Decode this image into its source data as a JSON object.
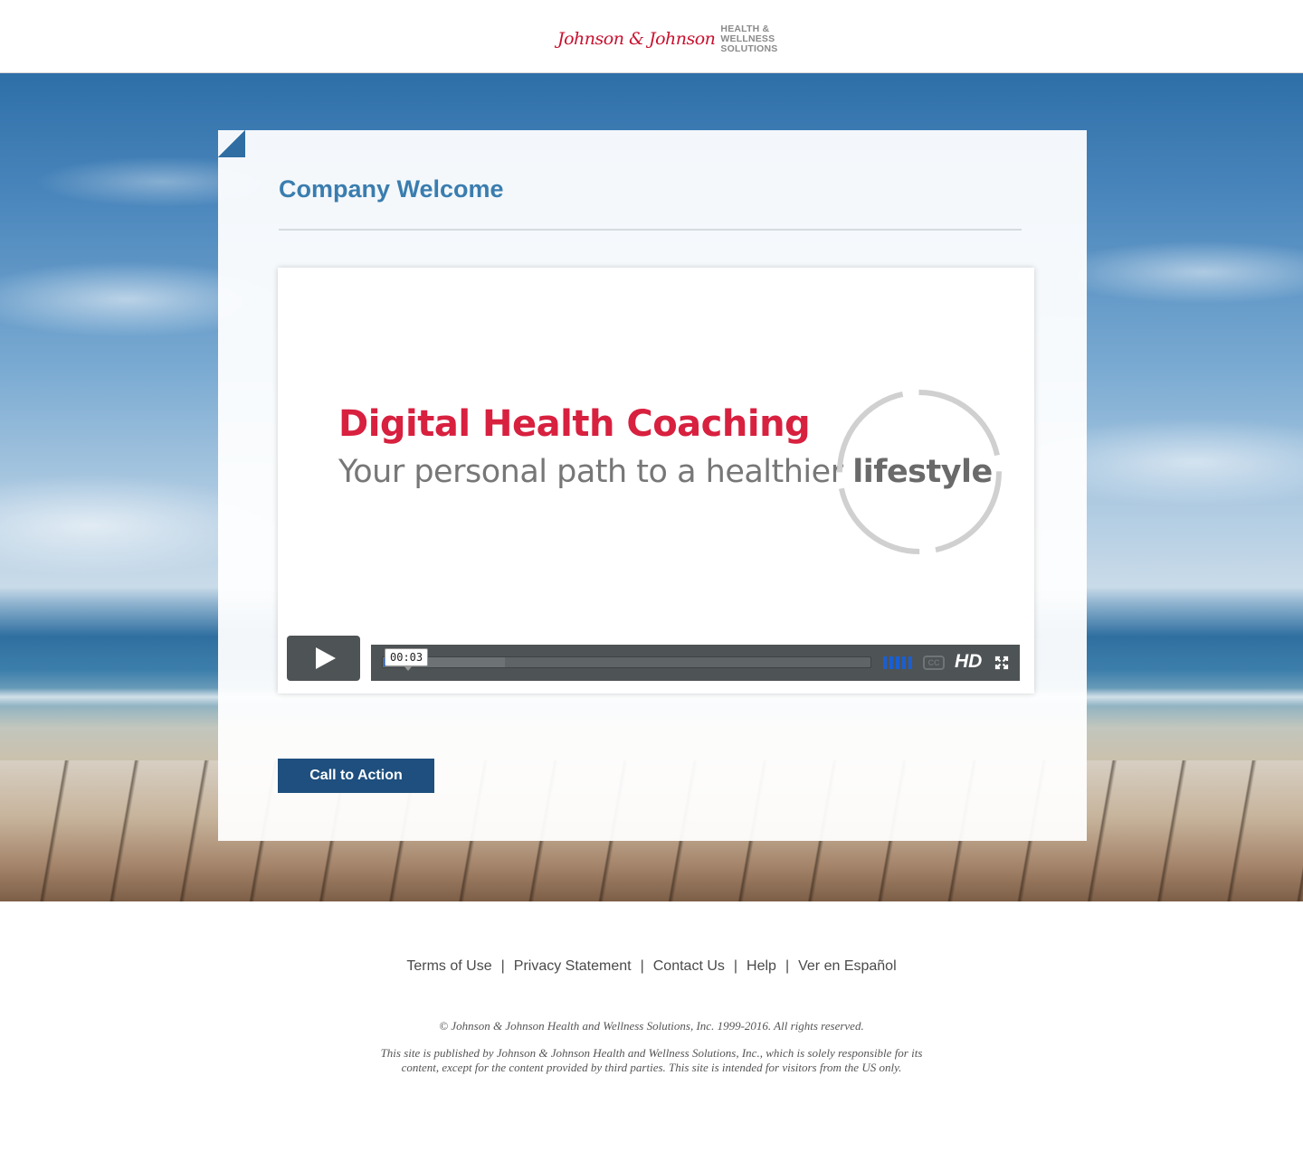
{
  "header": {
    "logo_script": "Johnson & Johnson",
    "logo_sub_1": "HEALTH &",
    "logo_sub_2": "WELLNESS",
    "logo_sub_3": "SOLUTIONS"
  },
  "main": {
    "title": "Company Welcome",
    "video": {
      "slide_title": "Digital Health Coaching",
      "slide_sub_prefix": "Your personal path to a healthier ",
      "slide_sub_bold": "lifestyle",
      "time": "00:03",
      "progress_fraction": 0.02,
      "buffered_fraction": 0.25,
      "cc_label": "CC",
      "hd_label": "HD"
    },
    "cta_label": "Call to Action"
  },
  "footer": {
    "links": [
      "Terms of Use",
      "Privacy Statement",
      "Contact Us",
      "Help",
      "Ver en Español"
    ],
    "separator": "|",
    "copyright": "© Johnson & Johnson Health and Wellness Solutions, Inc. 1999-2016. All rights reserved.",
    "disclaimer": "This site is published by Johnson & Johnson Health and Wellness Solutions, Inc., which is solely responsible for its content, except for the content provided by third parties.  This site is intended for visitors from the US only."
  },
  "colors": {
    "brand_red": "#c8102e",
    "title_blue": "#3a7daf",
    "cta_blue": "#1e4f7e",
    "progress_blue": "#1a5fd1"
  },
  "icons": {
    "play": "play-icon",
    "volume": "volume-icon",
    "fullscreen": "fullscreen-icon"
  }
}
